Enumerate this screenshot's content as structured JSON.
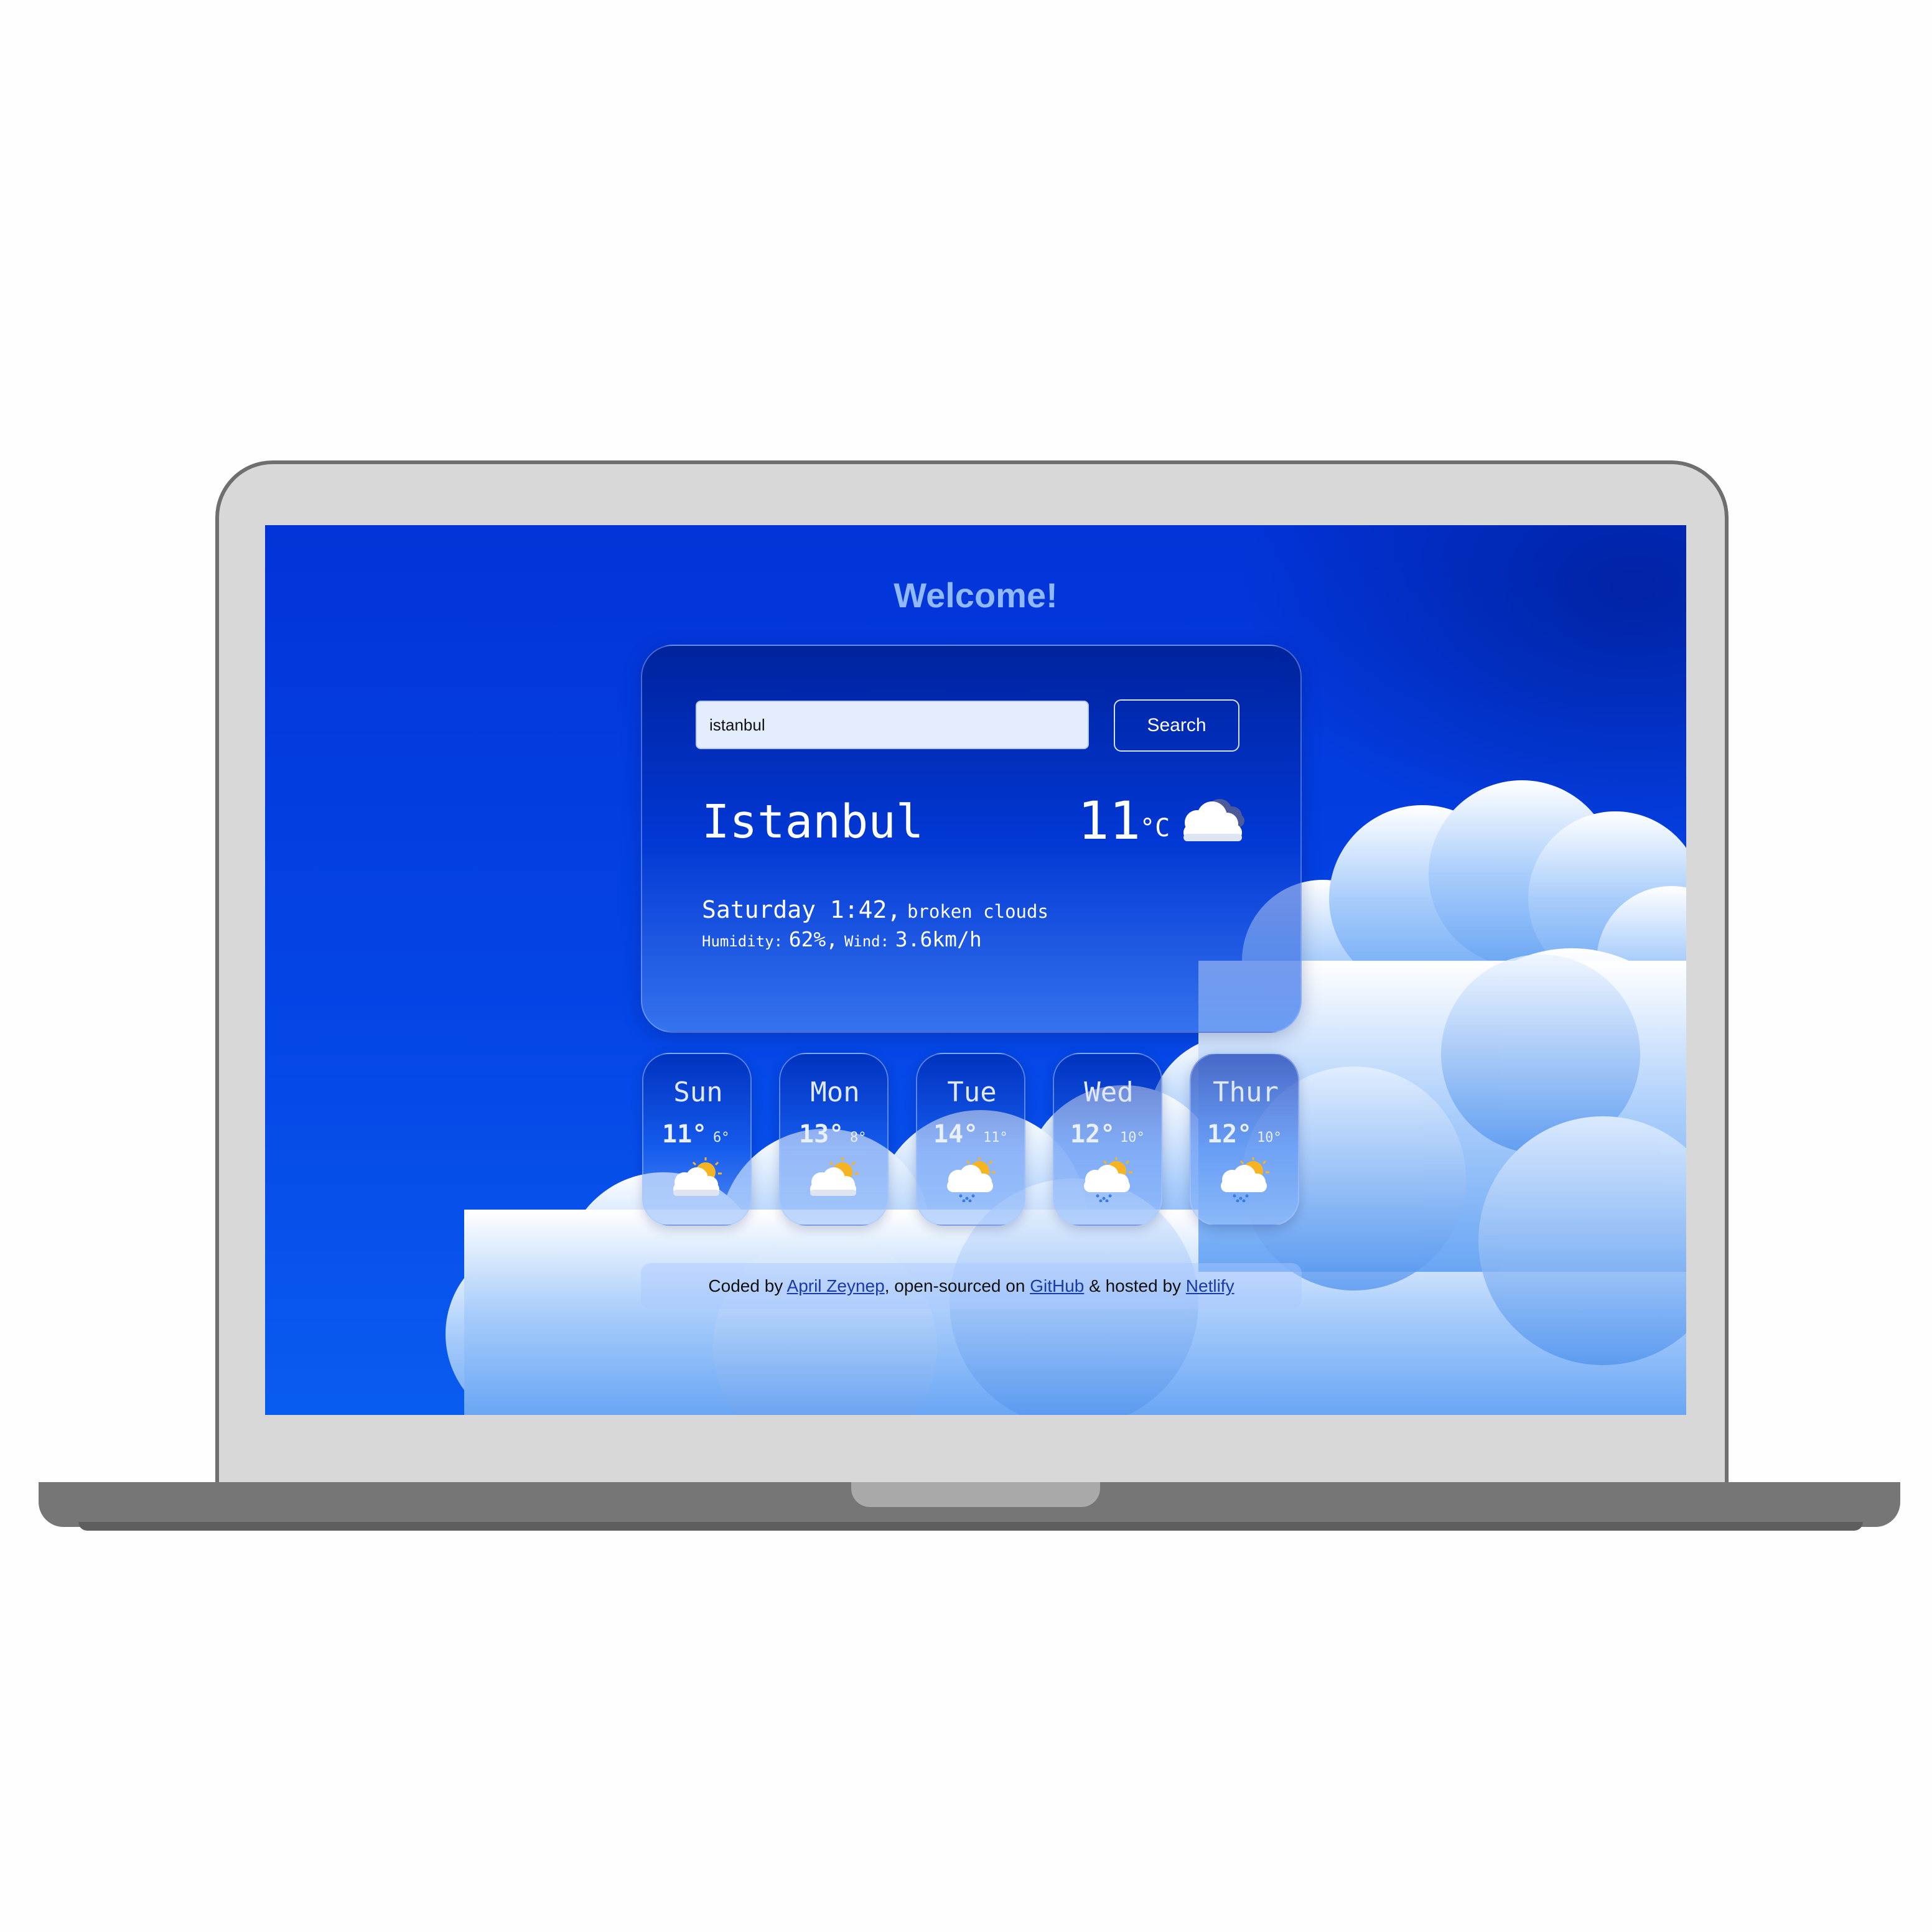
{
  "header": {
    "title": "Welcome!"
  },
  "search": {
    "value": "istanbul",
    "button_label": "Search"
  },
  "current": {
    "city": "Istanbul",
    "temperature": "11",
    "unit": "°C",
    "icon": "broken-clouds-icon",
    "day_time": "Saturday 1:42",
    "description": "broken clouds",
    "humidity_label": "Humidity:",
    "humidity_value": "62%",
    "wind_label": "Wind:",
    "wind_value": "3.6km/h"
  },
  "forecast": [
    {
      "day": "Sun",
      "high": "11°",
      "low": "6°",
      "icon": "partly-cloudy-icon"
    },
    {
      "day": "Mon",
      "high": "13°",
      "low": "8°",
      "icon": "partly-cloudy-icon"
    },
    {
      "day": "Tue",
      "high": "14°",
      "low": "11°",
      "icon": "partly-cloudy-rain-icon"
    },
    {
      "day": "Wed",
      "high": "12°",
      "low": "10°",
      "icon": "partly-cloudy-rain-icon"
    },
    {
      "day": "Thur",
      "high": "12°",
      "low": "10°",
      "icon": "partly-cloudy-rain-icon"
    }
  ],
  "footer": {
    "prefix": "Coded by ",
    "author": "April Zeynep",
    "mid": ", open-sourced on ",
    "repo": "GitHub",
    "mid2": " & hosted by ",
    "host": "Netlify"
  },
  "colors": {
    "accent": "#8fb8ff",
    "sky": "#0445e6",
    "frame": "#d8d8d8"
  }
}
